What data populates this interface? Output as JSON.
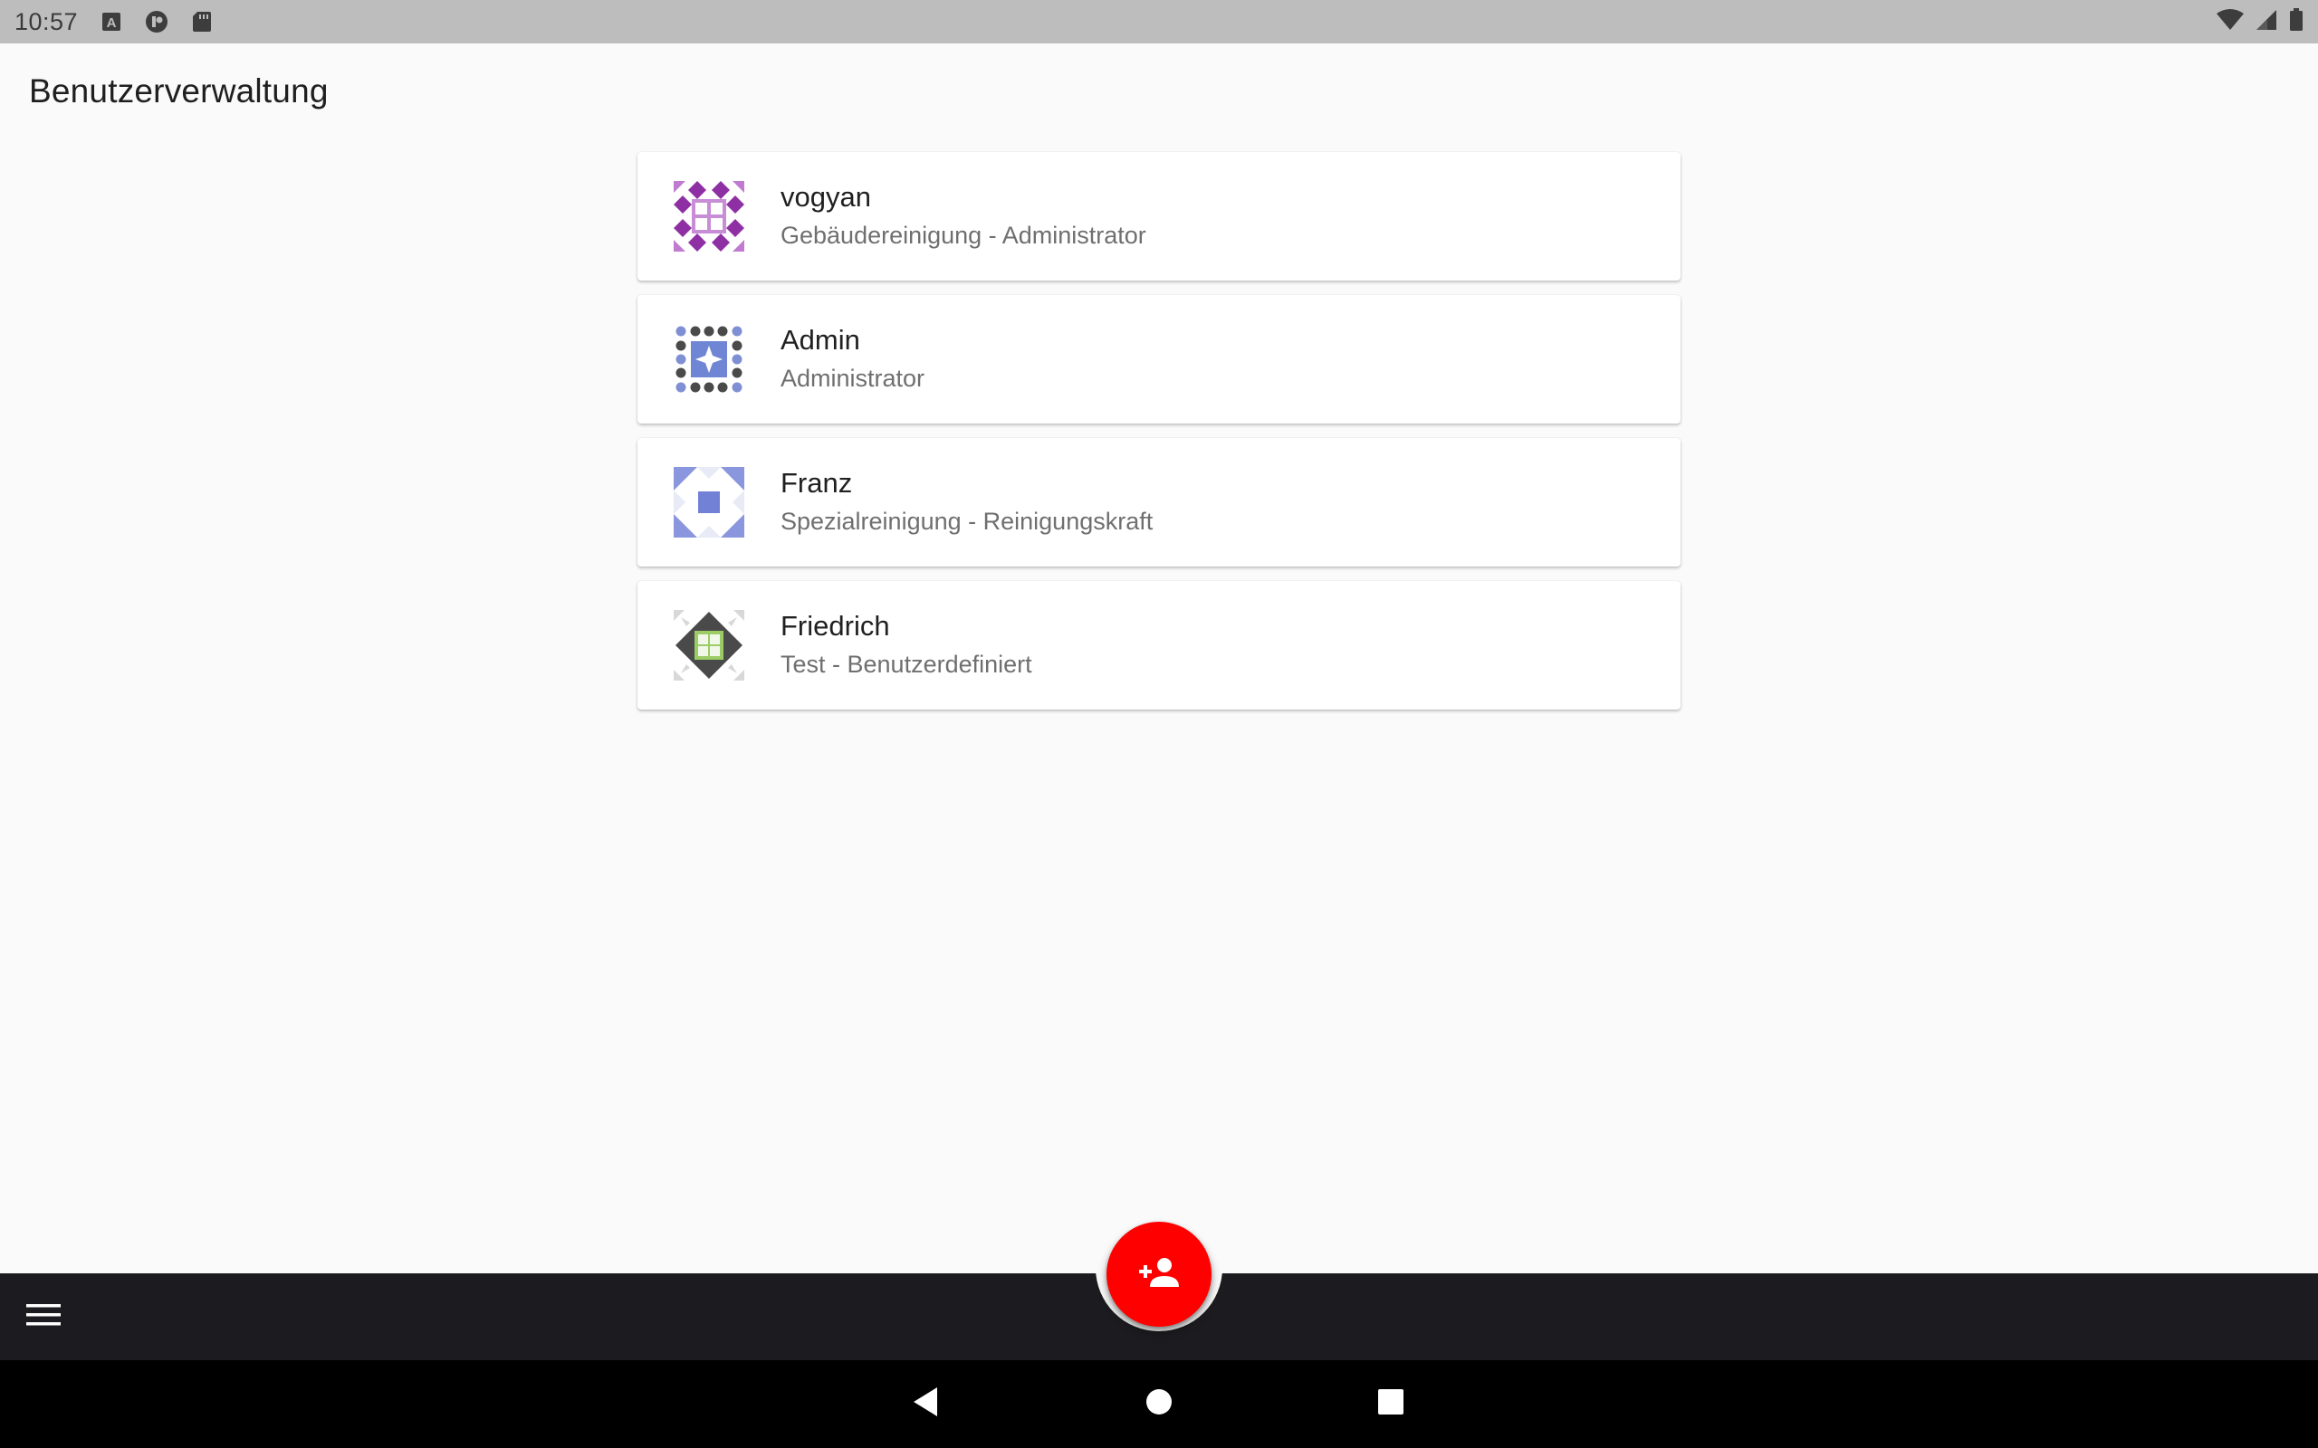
{
  "status_bar": {
    "time": "10:57",
    "icons": [
      "a-badge-icon",
      "app-circle-icon",
      "sd-card-icon",
      "wifi-icon",
      "signal-icon",
      "battery-icon"
    ]
  },
  "page": {
    "title": "Benutzerverwaltung"
  },
  "users": [
    {
      "name": "vogyan",
      "role": "Gebäudereinigung - Administrator",
      "avatar": "purple-quilt-avatar"
    },
    {
      "name": "Admin",
      "role": "Administrator",
      "avatar": "dots-star-avatar"
    },
    {
      "name": "Franz",
      "role": "Spezialreinigung - Reinigungskraft",
      "avatar": "blue-square-avatar"
    },
    {
      "name": "Friedrich",
      "role": "Test - Benutzerdefiniert",
      "avatar": "dark-diamond-avatar"
    }
  ],
  "bottom_bar": {
    "menu_icon": "hamburger-menu-icon",
    "fab_icon": "add-person-icon",
    "fab_color": "#ff0000"
  },
  "nav_bar": {
    "icons": [
      "back-triangle-icon",
      "home-circle-icon",
      "recents-square-icon"
    ]
  }
}
